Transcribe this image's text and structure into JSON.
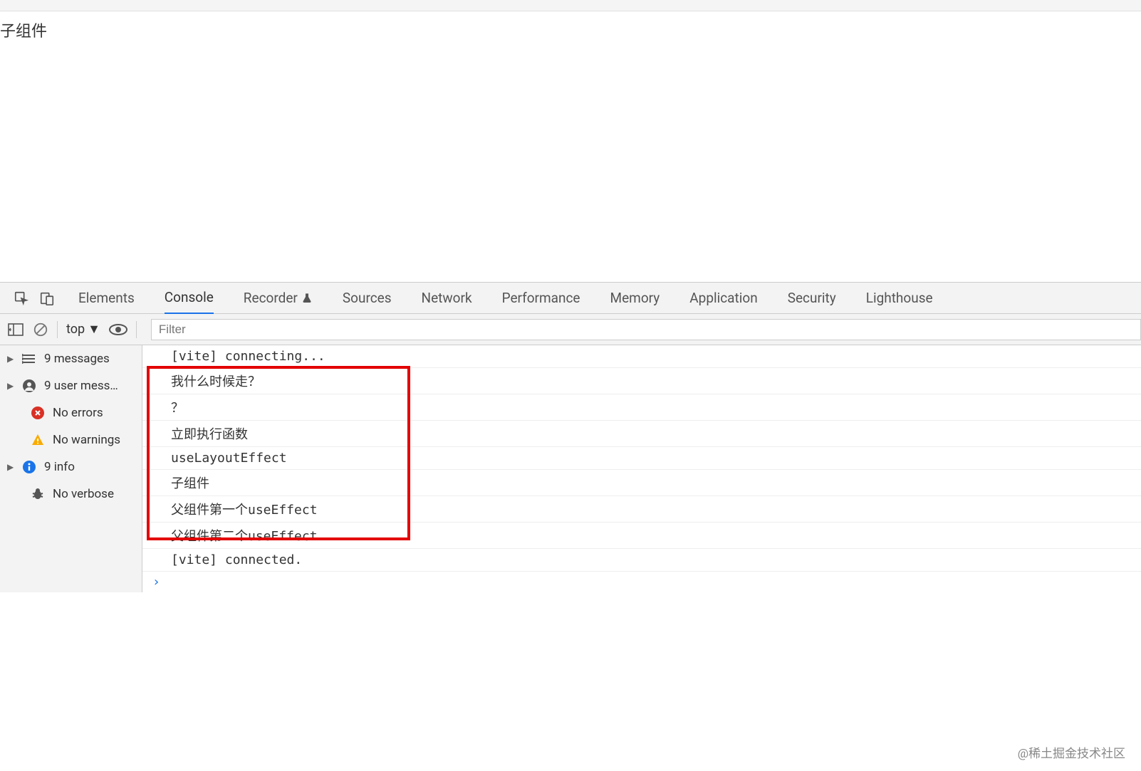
{
  "page": {
    "title": "子组件"
  },
  "devtools": {
    "tabs": {
      "elements": "Elements",
      "console": "Console",
      "recorder": "Recorder",
      "sources": "Sources",
      "network": "Network",
      "performance": "Performance",
      "memory": "Memory",
      "application": "Application",
      "security": "Security",
      "lighthouse": "Lighthouse"
    },
    "toolbar": {
      "context": "top",
      "filter_placeholder": "Filter"
    },
    "sidebar": {
      "messages": "9 messages",
      "user_messages": "9 user mess…",
      "no_errors": "No errors",
      "no_warnings": "No warnings",
      "info": "9 info",
      "no_verbose": "No verbose"
    },
    "console": {
      "lines": [
        "[vite] connecting...",
        "我什么时候走？",
        "？",
        "立即执行函数",
        "useLayoutEffect",
        "子组件",
        "父组件第一个useEffect",
        "父组件第二个useEffect",
        "[vite] connected."
      ],
      "prompt": "›"
    }
  },
  "watermark": "@稀土掘金技术社区"
}
